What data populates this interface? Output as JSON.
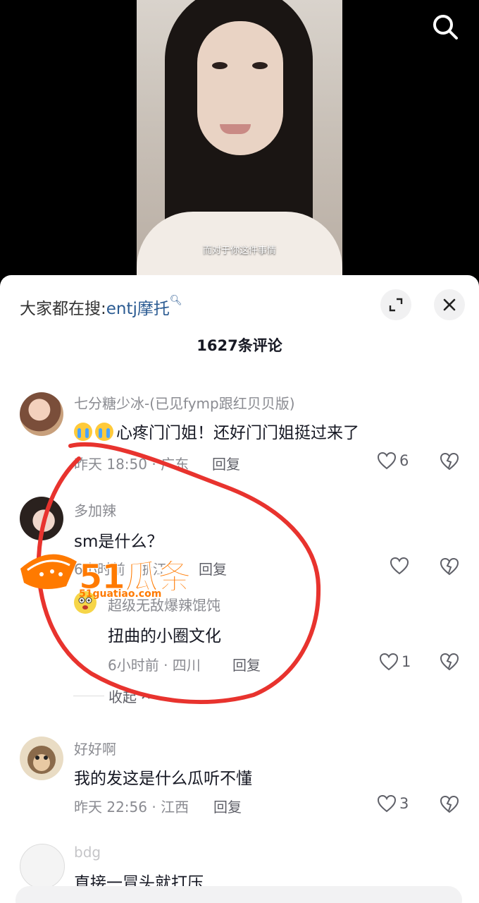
{
  "video": {
    "subtitle": "而对于你这件事情",
    "search_icon": "search-icon"
  },
  "sheet": {
    "hot_search_label": "大家都在搜:",
    "hot_search_term": "entj摩托",
    "comment_count": "1627条评论",
    "expand_icon": "expand-icon",
    "close_icon": "close-icon"
  },
  "comments": [
    {
      "name": "七分糖少冰-(已见fymp跟红贝贝版)",
      "text": "心疼门门姐！还好门门姐挺过来了",
      "emojis": [
        "crying-emoji",
        "crying-emoji"
      ],
      "meta": "昨天 18:50 · 广东",
      "reply": "回复",
      "likes": "6"
    },
    {
      "name": "多加辣",
      "text": "sm是什么？",
      "meta": "6小时前 · 浙江",
      "reply": "回复",
      "likes": "",
      "sub_reply": {
        "name": "超级无敌爆辣馄饨",
        "text": "扭曲的小圈文化",
        "meta": "6小时前 · 四川",
        "reply": "回复",
        "likes": "1"
      },
      "collapse": "收起"
    },
    {
      "name": "好好啊",
      "text": "我的发这是什么瓜听不懂",
      "meta": "昨天 22:56 · 江西",
      "reply": "回复",
      "likes": "3"
    },
    {
      "name": "bdg",
      "text": "直接一冒头就打压"
    }
  ],
  "watermark": {
    "brand": "51瓜条",
    "url": "51guatiao.com"
  },
  "colors": {
    "link": "#2b5b92",
    "annotation": "#e8332e",
    "watermark": "#ff7a00"
  }
}
